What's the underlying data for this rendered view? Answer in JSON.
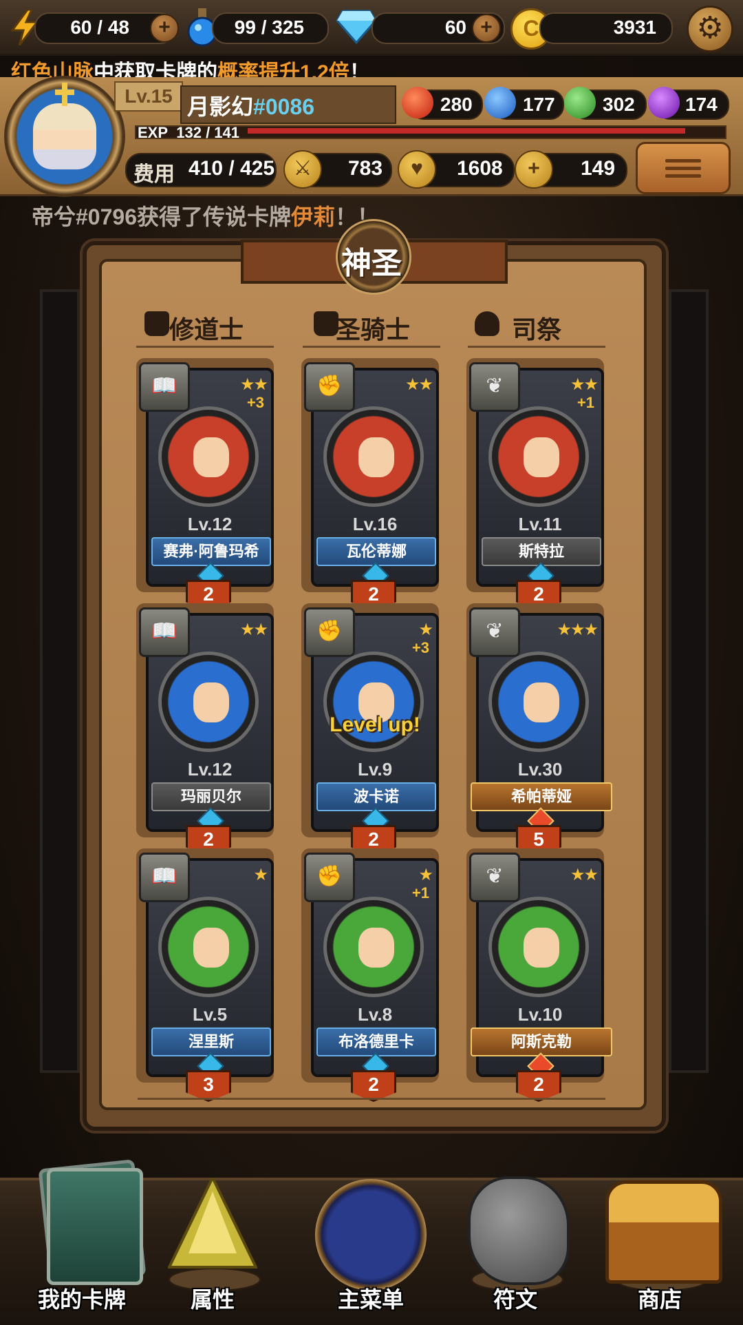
{
  "resources": {
    "energy": {
      "icon": "lightning-icon",
      "value": "60 / 48"
    },
    "potion": {
      "icon": "potion-icon",
      "value": "99 / 325"
    },
    "diamond": {
      "icon": "diamond-icon",
      "value": "60"
    },
    "gold": {
      "icon": "gold-coin-icon",
      "value": "3931"
    }
  },
  "banner": {
    "part1": "红色山脉",
    "part2": "中获取卡牌的",
    "part3": "概率提升1.2倍",
    "part4": "！"
  },
  "player": {
    "level": "Lv.15",
    "name": "月影幻",
    "id": "#0086",
    "exp_label": "EXP",
    "exp_value": "132 / 141",
    "exp_fraction": 0.936
  },
  "orbs": [
    {
      "name": "fire",
      "color": "#e0321e",
      "value": "280"
    },
    {
      "name": "water",
      "color": "#2a7ee0",
      "value": "177"
    },
    {
      "name": "nature",
      "color": "#3cb43a",
      "value": "302"
    },
    {
      "name": "dark",
      "color": "#9a2ad0",
      "value": "174"
    }
  ],
  "stats": {
    "cost_label": "费用",
    "cost_value": "410 / 425",
    "attack": "783",
    "health": "1608",
    "heal": "149"
  },
  "news": {
    "prefix": "帝兮#0796获得了传说卡牌",
    "card": "伊莉",
    "suffix": "！！"
  },
  "deck": {
    "title": "神圣",
    "classes": [
      "修道士",
      "圣骑士",
      "司祭"
    ],
    "cards": [
      {
        "stars": "★★",
        "plus": "+3",
        "level": "Lv.12",
        "name": "赛弗·阿鲁玛希",
        "plate": "blue",
        "count": "2",
        "bg": "#c8402a",
        "level_up": ""
      },
      {
        "stars": "★★",
        "plus": "",
        "level": "Lv.16",
        "name": "瓦伦蒂娜",
        "plate": "blue",
        "count": "2",
        "bg": "#c8402a",
        "level_up": ""
      },
      {
        "stars": "★★",
        "plus": "+1",
        "level": "Lv.11",
        "name": "斯特拉",
        "plate": "gray",
        "count": "2",
        "bg": "#c8402a",
        "level_up": ""
      },
      {
        "stars": "★★",
        "plus": "",
        "level": "Lv.12",
        "name": "玛丽贝尔",
        "plate": "gray",
        "count": "2",
        "bg": "#2a6fd0",
        "level_up": ""
      },
      {
        "stars": "★",
        "plus": "+3",
        "level": "Lv.9",
        "name": "波卡诺",
        "plate": "blue",
        "count": "2",
        "bg": "#2a6fd0",
        "level_up": "Level up!"
      },
      {
        "stars": "★★★",
        "plus": "",
        "level": "Lv.30",
        "name": "希帕蒂娅",
        "plate": "gold",
        "count": "5",
        "bg": "#2a6fd0",
        "level_up": ""
      },
      {
        "stars": "★",
        "plus": "",
        "level": "Lv.5",
        "name": "涅里斯",
        "plate": "blue",
        "count": "3",
        "bg": "#4aa83a",
        "level_up": ""
      },
      {
        "stars": "★",
        "plus": "+1",
        "level": "Lv.8",
        "name": "布洛德里卡",
        "plate": "blue",
        "count": "2",
        "bg": "#4aa83a",
        "level_up": ""
      },
      {
        "stars": "★★",
        "plus": "",
        "level": "Lv.10",
        "name": "阿斯克勒",
        "plate": "gold",
        "count": "2",
        "bg": "#4aa83a",
        "level_up": ""
      }
    ],
    "badges": [
      "book-icon",
      "fist-icon",
      "wings-icon"
    ]
  },
  "nav": [
    {
      "label": "我的卡牌",
      "icon": "cards-icon"
    },
    {
      "label": "属性",
      "icon": "triangle-crystal-icon"
    },
    {
      "label": "主菜单",
      "icon": "emblem-icon"
    },
    {
      "label": "符文",
      "icon": "rune-stone-icon"
    },
    {
      "label": "商店",
      "icon": "treasure-chest-icon"
    }
  ]
}
